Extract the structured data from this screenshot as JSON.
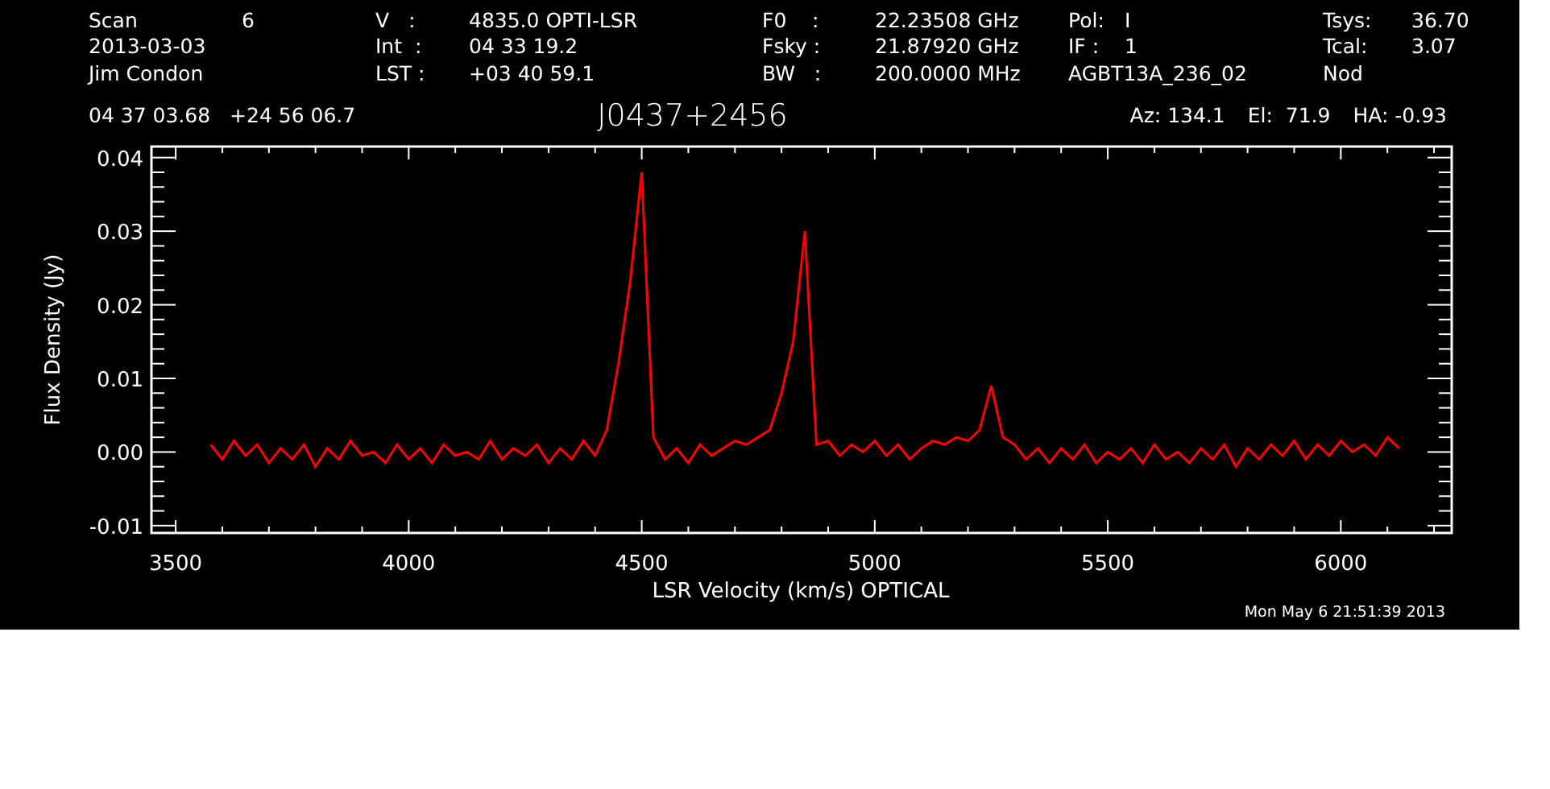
{
  "header": {
    "columns": [
      {
        "lines": [
          {
            "label": "Scan",
            "value": "6"
          },
          {
            "label": "2013-03-03"
          },
          {
            "label": "Jim Condon"
          }
        ]
      },
      {
        "lines": [
          {
            "label": "V   :",
            "value": "4835.0 OPTI-LSR"
          },
          {
            "label": "Int  :",
            "value": "04 33 19.2"
          },
          {
            "label": "LST :",
            "value": "+03 40 59.1"
          }
        ]
      },
      {
        "lines": [
          {
            "label": "F0    :",
            "value": "22.23508 GHz"
          },
          {
            "label": "Fsky :",
            "value": "21.87920 GHz"
          },
          {
            "label": "BW   :",
            "value": "200.0000 MHz"
          }
        ]
      },
      {
        "lines": [
          {
            "label": "Pol:",
            "value": "I"
          },
          {
            "label": "IF :",
            "value": "1"
          },
          {
            "label": "AGBT13A_236_02"
          }
        ]
      },
      {
        "lines": [
          {
            "label": "Tsys:",
            "value": "36.70"
          },
          {
            "label": "Tcal:",
            "value": "3.07"
          },
          {
            "label": "Nod"
          }
        ]
      }
    ]
  },
  "position": {
    "ra": "04 37 03.68",
    "dec": "+24 56 06.7"
  },
  "source": "J0437+2456",
  "pointing": [
    "Az: 134.1",
    "El:  71.9",
    "HA: -0.93"
  ],
  "chart_data": {
    "type": "line",
    "xlabel": "LSR Velocity (km/s) OPTICAL",
    "ylabel": "Flux Density (Jy)",
    "xlim": [
      3448,
      6238
    ],
    "ylim": [
      -0.011,
      0.0415
    ],
    "xticks": [
      3500,
      4000,
      4500,
      5000,
      5500,
      6000
    ],
    "yticks": [
      {
        "value": -0.01,
        "label": "-0.01"
      },
      {
        "value": 0,
        "label": "0.00"
      },
      {
        "value": 0.01,
        "label": "0.01"
      },
      {
        "value": 0.02,
        "label": "0.02"
      },
      {
        "value": 0.03,
        "label": "0.03"
      },
      {
        "value": 0.04,
        "label": "0.04"
      }
    ],
    "x": [
      3575,
      3600,
      3625,
      3650,
      3675,
      3700,
      3725,
      3750,
      3775,
      3800,
      3825,
      3850,
      3875,
      3900,
      3925,
      3950,
      3975,
      4000,
      4025,
      4050,
      4075,
      4100,
      4125,
      4150,
      4175,
      4200,
      4225,
      4250,
      4275,
      4300,
      4325,
      4350,
      4375,
      4400,
      4425,
      4450,
      4475,
      4500,
      4525,
      4550,
      4575,
      4600,
      4625,
      4650,
      4675,
      4700,
      4725,
      4750,
      4775,
      4800,
      4825,
      4850,
      4875,
      4900,
      4925,
      4950,
      4975,
      5000,
      5025,
      5050,
      5075,
      5100,
      5125,
      5150,
      5175,
      5200,
      5225,
      5250,
      5275,
      5300,
      5325,
      5350,
      5375,
      5400,
      5425,
      5450,
      5475,
      5500,
      5525,
      5550,
      5575,
      5600,
      5625,
      5650,
      5675,
      5700,
      5725,
      5750,
      5775,
      5800,
      5825,
      5850,
      5875,
      5900,
      5925,
      5950,
      5975,
      6000,
      6025,
      6050,
      6075,
      6100,
      6125
    ],
    "series": [
      {
        "color": "#ff0000",
        "values": [
          0.001,
          -0.001,
          0.0015,
          -0.0005,
          0.001,
          -0.0015,
          0.0005,
          -0.001,
          0.001,
          -0.002,
          0.0005,
          -0.001,
          0.0015,
          -0.0005,
          0.0,
          -0.0015,
          0.001,
          -0.001,
          0.0005,
          -0.0015,
          0.001,
          -0.0005,
          0.0,
          -0.001,
          0.0015,
          -0.001,
          0.0005,
          -0.0005,
          0.001,
          -0.0015,
          0.0005,
          -0.001,
          0.0015,
          -0.0005,
          0.003,
          0.012,
          0.023,
          0.038,
          0.002,
          -0.001,
          0.0005,
          -0.0015,
          0.001,
          -0.0005,
          0.0005,
          0.0015,
          0.001,
          0.002,
          0.003,
          0.008,
          0.015,
          0.03,
          0.001,
          0.0015,
          -0.0005,
          0.001,
          0.0,
          0.0015,
          -0.0005,
          0.001,
          -0.001,
          0.0005,
          0.0015,
          0.001,
          0.002,
          0.0015,
          0.003,
          0.009,
          0.002,
          0.001,
          -0.001,
          0.0005,
          -0.0015,
          0.0005,
          -0.001,
          0.001,
          -0.0015,
          0.0,
          -0.001,
          0.0005,
          -0.0015,
          0.001,
          -0.001,
          0.0,
          -0.0015,
          0.0005,
          -0.001,
          0.001,
          -0.002,
          0.0005,
          -0.001,
          0.001,
          -0.0005,
          0.0015,
          -0.001,
          0.001,
          -0.0005,
          0.0015,
          0.0,
          0.001,
          -0.0005,
          0.002,
          0.0005
        ]
      }
    ]
  },
  "timestamp": "Mon May  6 21:51:39 2013"
}
